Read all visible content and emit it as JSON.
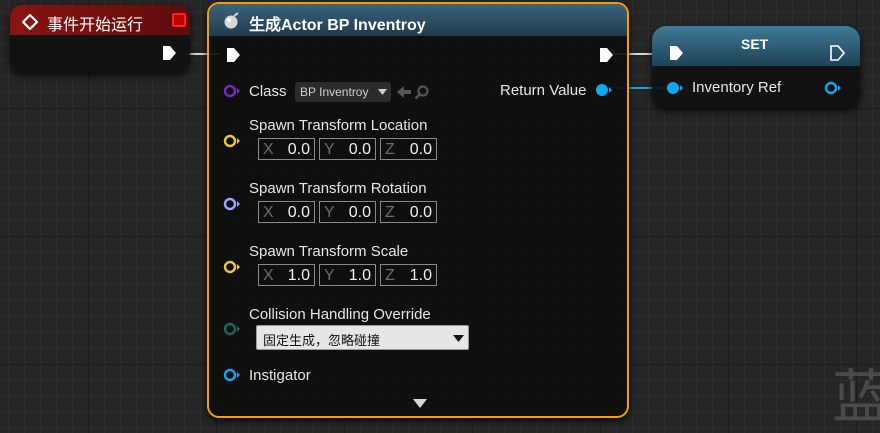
{
  "event_node": {
    "title": "事件开始运行"
  },
  "spawn_node": {
    "title": "生成Actor BP Inventroy",
    "class_label": "Class",
    "class_value": "BP Inventroy",
    "return_label": "Return Value",
    "location_label": "Spawn Transform Location",
    "location": {
      "x": "0.0",
      "y": "0.0",
      "z": "0.0"
    },
    "rotation_label": "Spawn Transform Rotation",
    "rotation": {
      "x": "0.0",
      "y": "0.0",
      "z": "0.0"
    },
    "scale_label": "Spawn Transform Scale",
    "scale": {
      "x": "1.0",
      "y": "1.0",
      "z": "1.0"
    },
    "collision_label": "Collision Handling Override",
    "collision_value": "固定生成，忽略碰撞",
    "instigator_label": "Instigator"
  },
  "set_node": {
    "title": "SET",
    "var_label": "Inventory Ref"
  },
  "axis_labels": {
    "x": "X",
    "y": "Y",
    "z": "Z"
  },
  "watermark": "蓝",
  "colors": {
    "event_header": "#7a1010",
    "spawn_header": "#2b4a5e",
    "set_header": "#2a5a72",
    "selection_outline": "#f5a000",
    "exec": "#ffffff",
    "class_pin": "#6a1fb0",
    "vector_pin": "#f0c33a",
    "rotator_pin": "#a0a4ff",
    "enum_pin": "#1a6a5a",
    "object_pin": "#12a6ef"
  }
}
